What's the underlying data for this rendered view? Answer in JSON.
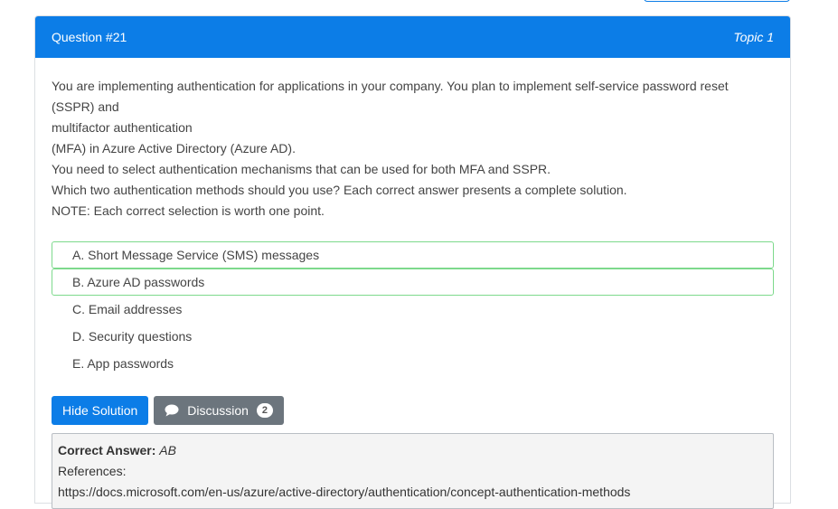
{
  "question": {
    "number_label": "Question #21",
    "topic_label": "Topic 1",
    "text_lines": [
      "You are implementing authentication for applications in your company. You plan to implement self-service password reset (SSPR) and",
      "multifactor authentication",
      "(MFA) in Azure Active Directory (Azure AD).",
      "You need to select authentication mechanisms that can be used for both MFA and SSPR.",
      "Which two authentication methods should you use? Each correct answer presents a complete solution.",
      "NOTE: Each correct selection is worth one point."
    ]
  },
  "choices": [
    {
      "label": "A. Short Message Service (SMS) messages",
      "correct": true
    },
    {
      "label": "B. Azure AD passwords",
      "correct": true
    },
    {
      "label": "C. Email addresses",
      "correct": false
    },
    {
      "label": "D. Security questions",
      "correct": false
    },
    {
      "label": "E. App passwords",
      "correct": false
    }
  ],
  "buttons": {
    "hide_solution": "Hide Solution",
    "discussion": "Discussion",
    "discussion_count": "2"
  },
  "answer": {
    "correct_label": "Correct Answer:",
    "correct_value": "AB",
    "references_label": "References:",
    "reference_url": "https://docs.microsoft.com/en-us/azure/active-directory/authentication/concept-authentication-methods"
  },
  "colors": {
    "accent": "#0c7de7",
    "secondary": "#6c757d",
    "correct_border": "#7dd98c"
  },
  "icons": {
    "discussion": "chat-bubble-icon"
  }
}
